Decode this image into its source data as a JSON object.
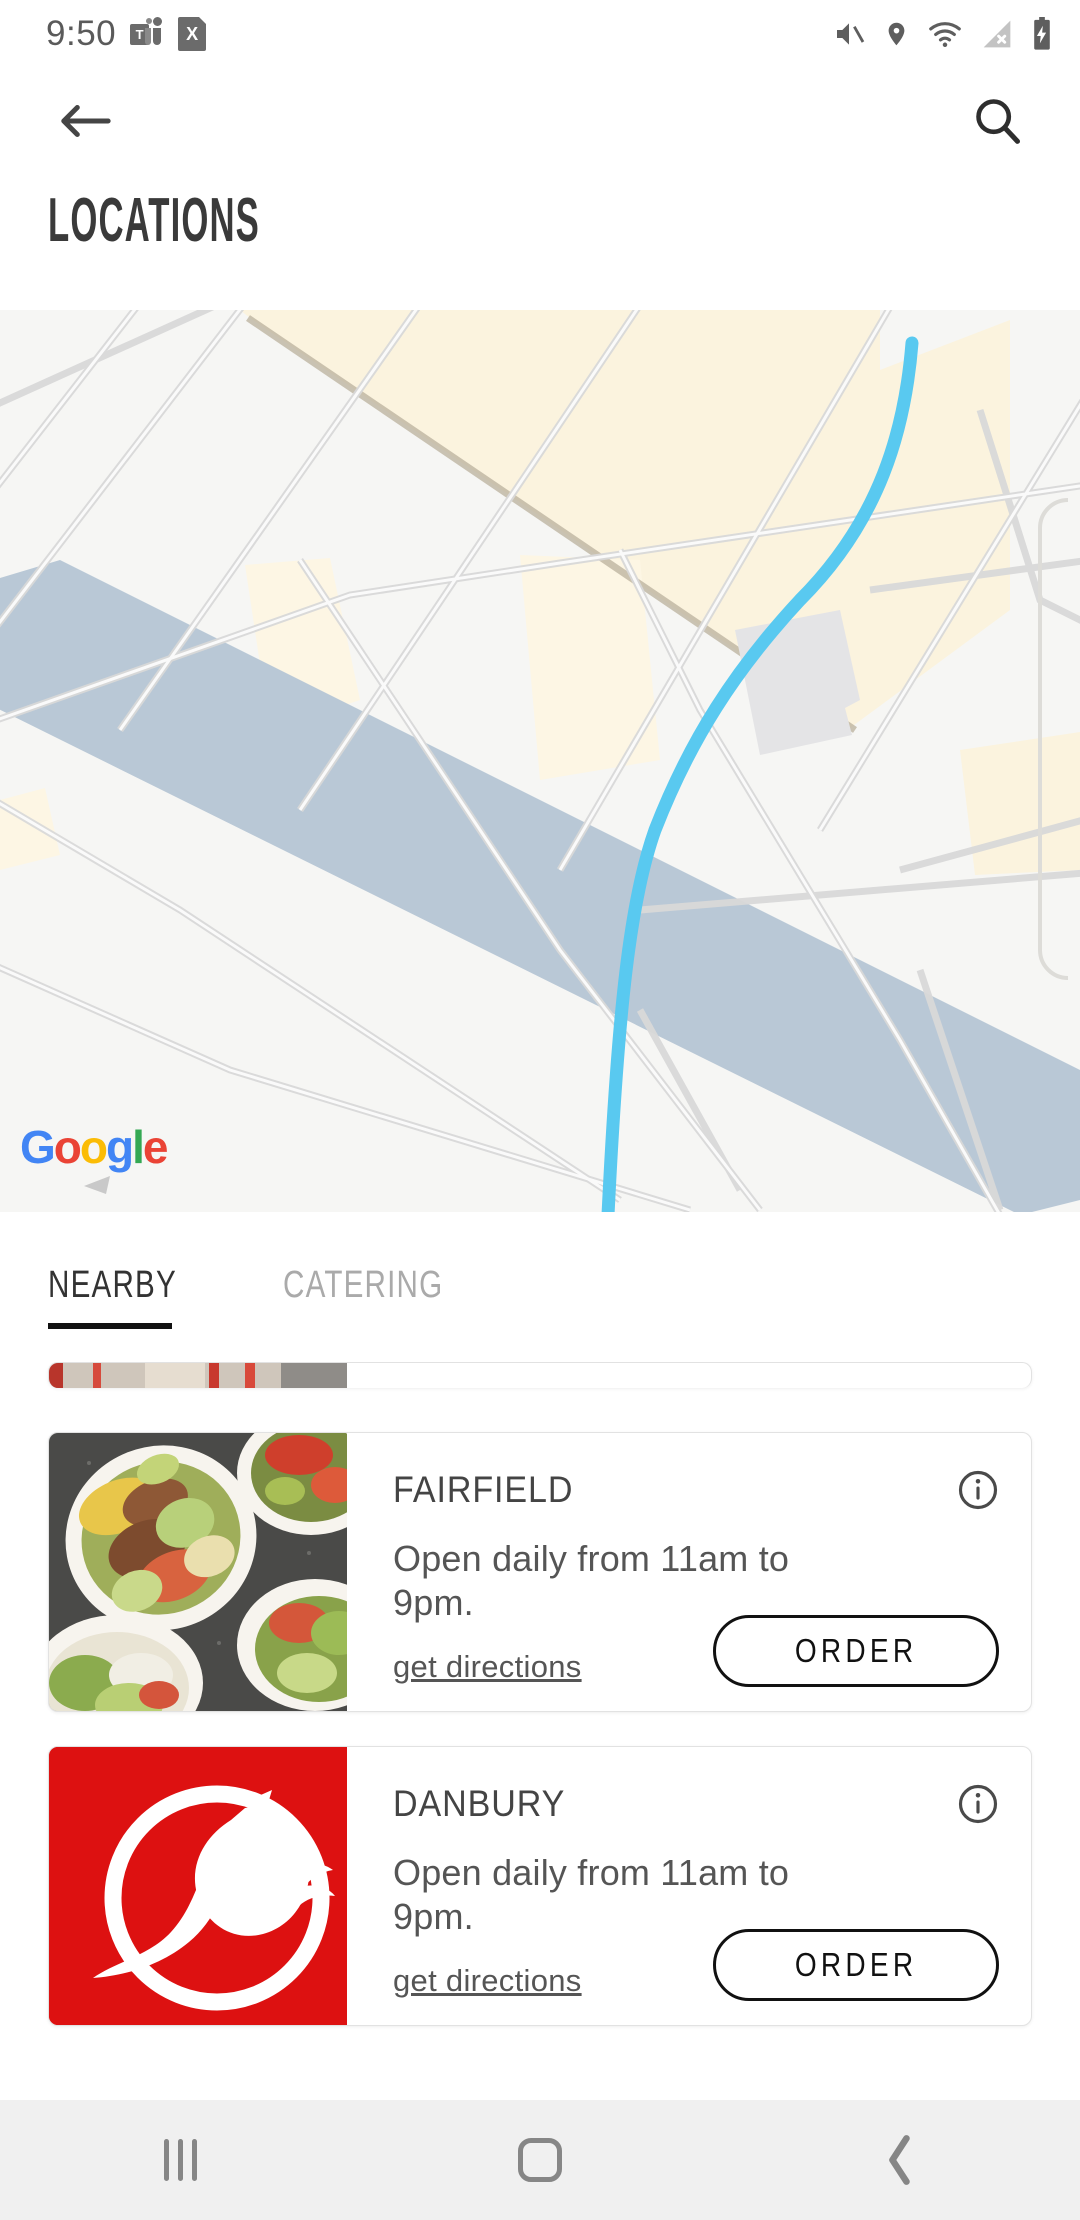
{
  "status_bar": {
    "time": "9:50",
    "left_icons": [
      {
        "name": "teams-icon",
        "glyph": "T"
      },
      {
        "name": "excel-icon",
        "glyph": "X"
      }
    ],
    "right_icons": [
      {
        "name": "mute-icon"
      },
      {
        "name": "location-pin-icon"
      },
      {
        "name": "wifi-icon"
      },
      {
        "name": "cellular-off-icon"
      },
      {
        "name": "battery-charging-icon"
      }
    ]
  },
  "app_bar": {
    "back_icon": "back-arrow-icon",
    "search_icon": "search-icon",
    "title": "LOCATIONS"
  },
  "map": {
    "provider_logo": "Google",
    "logo_letters": [
      "G",
      "o",
      "o",
      "g",
      "l",
      "e"
    ],
    "colors": {
      "background": "#f6f6f4",
      "road": "#dcdcdc",
      "river": "#b4c4d4",
      "route": "#57c8ef",
      "park": "#faf2dc",
      "building": "#e4e4e6"
    }
  },
  "tabs": [
    {
      "label": "NEARBY",
      "active": true
    },
    {
      "label": "CATERING",
      "active": false
    }
  ],
  "locations": [
    {
      "name": "",
      "hours": "",
      "directions_label": "",
      "order_label": "",
      "thumb_type": "storefront-photo",
      "partial": true
    },
    {
      "name": "FAIRFIELD",
      "hours": "Open daily from 11am to 9pm.",
      "directions_label": "get directions",
      "order_label": "ORDER",
      "info_icon": "info-icon",
      "thumb_type": "food-photo",
      "partial": false
    },
    {
      "name": "DANBURY",
      "hours": "Open daily from 11am to 9pm.",
      "directions_label": "get directions",
      "order_label": "ORDER",
      "info_icon": "info-icon",
      "thumb_type": "brand-logo",
      "brand_color": "#DD1111",
      "partial": false
    }
  ],
  "nav_bar": {
    "recents_label": "recents-button",
    "home_label": "home-button",
    "back_label": "back-button"
  }
}
